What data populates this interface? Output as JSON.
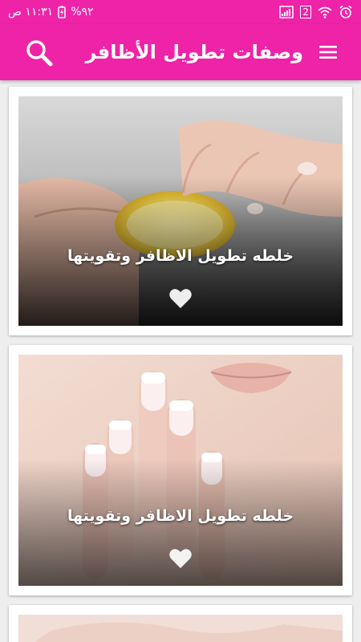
{
  "status_bar": {
    "time": "١١:٣١ ص",
    "battery": "%٩٢",
    "sim_slot": "2",
    "icons": [
      "battery-charging-icon",
      "signal-icon",
      "wifi-icon",
      "alarm-icon"
    ]
  },
  "app_bar": {
    "title": "وصفات تطويل الأظافر",
    "icons": [
      "search-icon",
      "menu-icon"
    ]
  },
  "colors": {
    "primary": "#ee23a8",
    "background": "#eeeeee",
    "card": "#ffffff"
  },
  "cards": [
    {
      "caption": "خلطه تطويل الاظافر وتقويتها",
      "icon": "heart-icon"
    },
    {
      "caption": "خلطه تطويل الاظافر وتقويتها",
      "icon": "heart-icon"
    }
  ]
}
